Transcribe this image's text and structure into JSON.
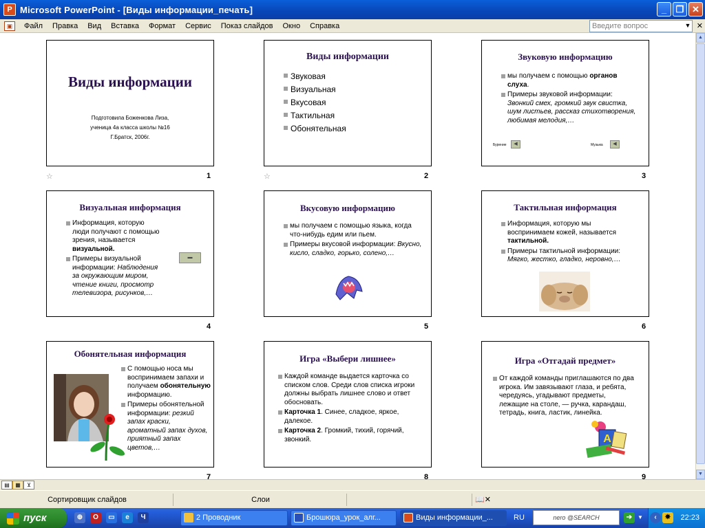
{
  "window": {
    "title": "Microsoft PowerPoint - [Виды  информации_печать]",
    "app_icon": "powerpoint-icon"
  },
  "menu": {
    "items": [
      "Файл",
      "Правка",
      "Вид",
      "Вставка",
      "Формат",
      "Сервис",
      "Показ слайдов",
      "Окно",
      "Справка"
    ],
    "ask_placeholder": "Введите вопрос"
  },
  "slides": [
    {
      "number": "1",
      "title": "Виды  информации",
      "subtitle_lines": [
        "Подготовила Боженкова Лиза,",
        "ученица 4а класса школы №16",
        "Г.Братск, 2006г."
      ]
    },
    {
      "number": "2",
      "title": "Виды информации",
      "bullets": [
        "Звуковая",
        "Визуальная",
        "Вкусовая",
        "Тактильная",
        "Обонятельная"
      ]
    },
    {
      "number": "3",
      "title": "Звуковую информацию",
      "b1_pre": "мы получаем с помощью ",
      "b1_bold": "органов слуха",
      "b1_post": ".",
      "b2_plain": "Примеры звуковой информации: ",
      "b2_italic": "Звонкий смех, громкий звук свистка, шум листьев, рассказ стихотворения, любимая мелодия,…",
      "nav_left_label": "Бурение",
      "nav_right_label": "Музыка"
    },
    {
      "number": "4",
      "title": "Визуальная информация",
      "b1_pre": "Информация, которую люди получают с помощью зрения, называется ",
      "b1_bold": "визуальной.",
      "b2_plain": "Примеры визуальной информации: ",
      "b2_italic": "Наблюдения за окружающим миром, чтение книги, просмотр телевизора, рисунков,…"
    },
    {
      "number": "5",
      "title": "Вкусовую информацию",
      "b1": "мы получаем с помощью языка, когда что-нибудь едим или пьем.",
      "b2_plain": "Примеры вкусовой информации: ",
      "b2_italic": "Вкусно, кисло, сладко, горько, солено,…"
    },
    {
      "number": "6",
      "title": "Тактильная информация",
      "b1_pre": "Информация, которую мы воспринимаем кожей, называется ",
      "b1_bold": "тактильной.",
      "b2_plain": "Примеры тактильной информации: ",
      "b2_italic": "Мягко, жестко, гладко, неровно,…"
    },
    {
      "number": "7",
      "title": "Обонятельная информация",
      "b1_pre": "С помощью носа мы воспринимаем запахи и получаем ",
      "b1_bold": "обонятельную",
      "b1_post": " информацию.",
      "b2_plain": "Примеры обонятельной информации: ",
      "b2_italic": "резкий запах краски, ароматный запах духов, приятный запах цветов,…"
    },
    {
      "number": "8",
      "title": "Игра «Выбери лишнее»",
      "b1": "Каждой команде выдается карточка со списком слов. Среди слов списка игроки должны выбрать лишнее слово и ответ обосновать.",
      "b2_bold": "Карточка 1",
      "b2_rest": ". Синее, сладкое, яркое, далекое.",
      "b3_bold": "Карточка 2",
      "b3_rest": ". Громкий, тихий, горячий, звонкий."
    },
    {
      "number": "9",
      "title": "Игра «Отгадай предмет»",
      "b1": "От каждой команды приглашаются по два игрока. Им завязывают глаза, и ребята, чередуясь, угадывают предметы, лежащие на столе, — ручка, карандаш, тетрадь, книга, ластик, линейка."
    }
  ],
  "status": {
    "view": "Сортировщик слайдов",
    "layers": "Слои"
  },
  "taskbar": {
    "start": "пуск",
    "tasks": [
      "2 Проводник",
      "Брошюра_урок_алг...",
      "Виды  информации_..."
    ],
    "lang": "RU",
    "nero": "nero @SEARCH",
    "clock": "22:23"
  }
}
